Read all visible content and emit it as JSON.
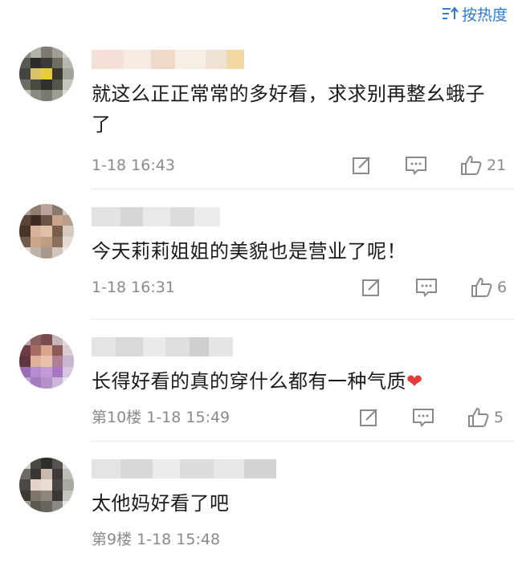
{
  "header": {
    "sort_label": "按热度",
    "sort_icon": "sort-icon"
  },
  "colors": {
    "accent": "#2d7bd8",
    "meta": "#8a8a8a",
    "text": "#1a1a1a",
    "heart": "#e23b3b"
  },
  "comments": [
    {
      "text": "就这么正正常常的多好看，求求别再整幺蛾子了",
      "floor": "",
      "time": "1-18 16:43",
      "likes": "21"
    },
    {
      "text": "今天莉莉姐姐的美貌也是营业了呢！",
      "floor": "",
      "time": "1-18 16:31",
      "likes": "6"
    },
    {
      "text": "长得好看的真的穿什么都有一种气质",
      "emoji": "❤",
      "floor": "第10楼",
      "time": "1-18 15:49",
      "likes": "5"
    },
    {
      "text": "太他妈好看了吧",
      "floor": "第9楼",
      "time": "1-18 15:48",
      "likes": ""
    }
  ]
}
